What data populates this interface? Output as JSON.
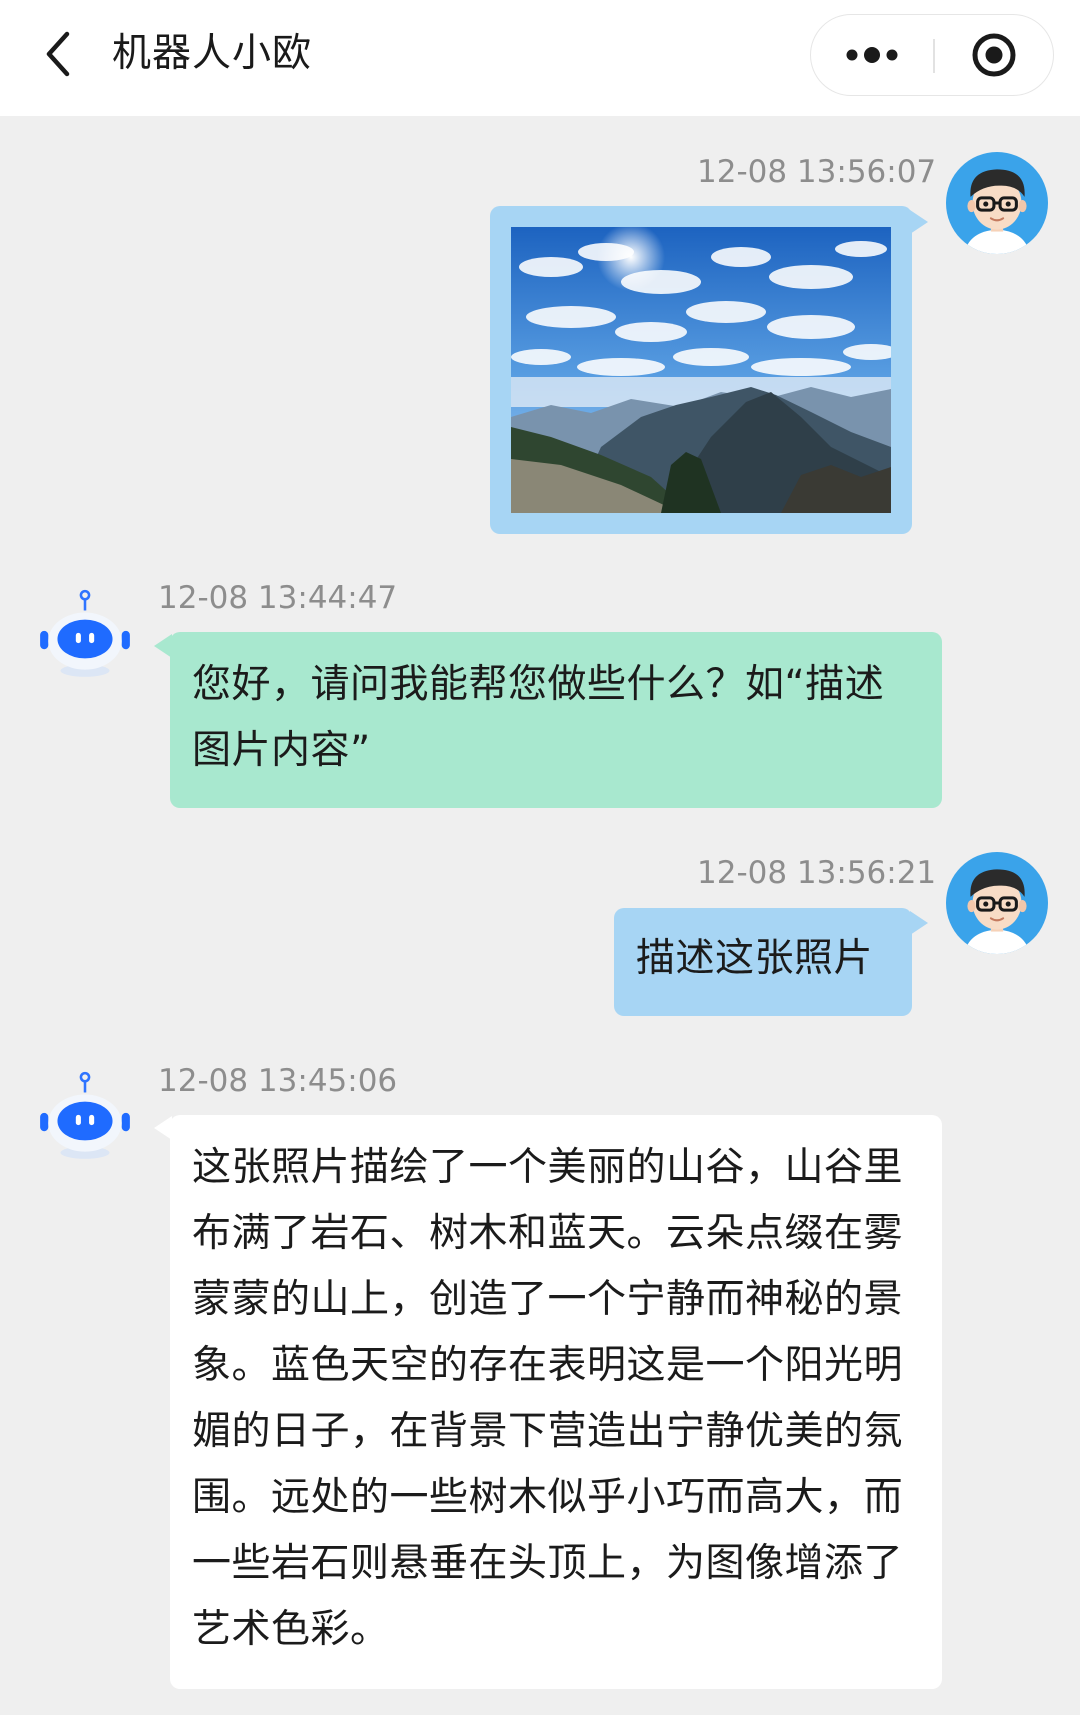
{
  "header": {
    "title": "机器人小欧"
  },
  "messages": [
    {
      "sender": "user",
      "type": "image",
      "timestamp": "12-08 13:56:07"
    },
    {
      "sender": "bot",
      "type": "text",
      "timestamp": "12-08 13:44:47",
      "text": "您好，请问我能帮您做些什么？如“描述图片内容”"
    },
    {
      "sender": "user",
      "type": "text",
      "timestamp": "12-08 13:56:21",
      "text": "描述这张照片"
    },
    {
      "sender": "bot",
      "type": "text",
      "timestamp": "12-08 13:45:06",
      "text": "这张照片描绘了一个美丽的山谷，山谷里布满了岩石、树木和蓝天。云朵点缀在雾蒙蒙的山上，创造了一个宁静而神秘的景象。蓝色天空的存在表明这是一个阳光明媚的日子，在背景下营造出宁静优美的氛围。远处的一些树木似乎小巧而高大，而一些岩石则悬垂在头顶上，为图像增添了艺术色彩。"
    }
  ],
  "colors": {
    "background": "#efefef",
    "user_bubble": "#a7d5f4",
    "bot_bubble_first": "#a8e8cf",
    "bot_bubble": "#ffffff",
    "timestamp": "#8d8d8d"
  },
  "icons": {
    "back": "chevron-left-icon",
    "more": "more-dots-icon",
    "close": "target-circle-icon",
    "user_avatar": "user-avatar-glasses",
    "bot_avatar": "robot-avatar"
  }
}
